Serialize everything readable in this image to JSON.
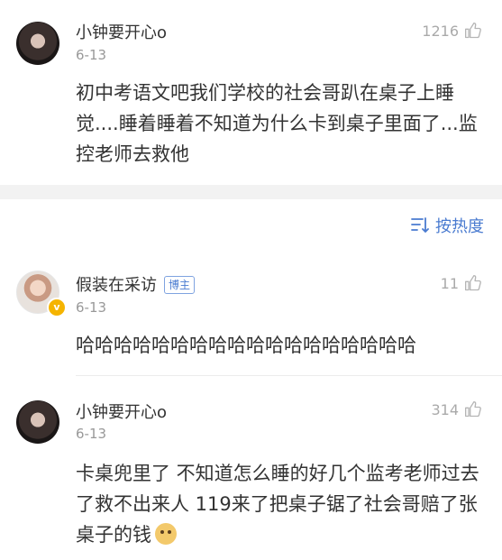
{
  "comments": [
    {
      "username": "小钟要开心o",
      "date": "6-13",
      "likes": "1216",
      "text": "初中考语文吧我们学校的社会哥趴在桌子上睡觉....睡着睡着不知道为什么卡到桌子里面了...监控老师去救他"
    },
    {
      "username": "假装在采访",
      "tag": "博主",
      "date": "6-13",
      "likes": "11",
      "text": "哈哈哈哈哈哈哈哈哈哈哈哈哈哈哈哈哈哈"
    },
    {
      "username": "小钟要开心o",
      "date": "6-13",
      "likes": "314",
      "text": "卡桌兜里了 不知道怎么睡的好几个监考老师过去了救不出来人 119来了把桌子锯了社会哥赔了张桌子的钱"
    }
  ],
  "sort": {
    "label": "按热度",
    "icon": "sort-icon"
  },
  "colors": {
    "accent": "#4a7bd0",
    "badge": "#f5b400",
    "muted": "#999999"
  }
}
